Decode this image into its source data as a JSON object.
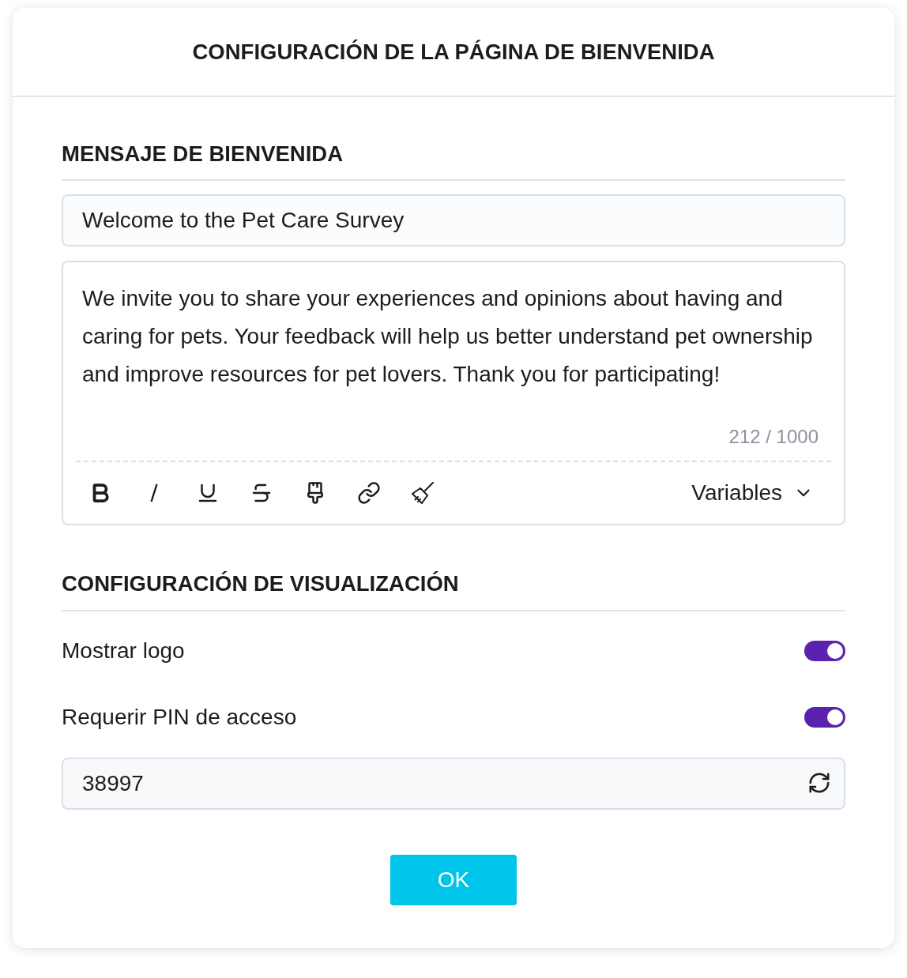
{
  "dialog": {
    "title": "CONFIGURACIÓN DE LA PÁGINA DE BIENVENIDA"
  },
  "welcome_message": {
    "heading": "MENSAJE DE BIENVENIDA",
    "title_field": {
      "value": "Welcome to the Pet Care Survey"
    },
    "body_field": {
      "value": "We invite you to share your experiences and opinions about having and caring for pets. Your feedback will help us better understand pet ownership and improve resources for pet lovers. Thank you for participating!",
      "counter": "212 / 1000"
    },
    "toolbar": {
      "dropdown": "Variables"
    }
  },
  "display_settings": {
    "heading": "CONFIGURACIÓN DE VISUALIZACIÓN",
    "toggles": [
      {
        "label": "Mostrar logo",
        "on": true
      },
      {
        "label": "Requerir PIN de acceso",
        "on": true
      }
    ],
    "pin_field": {
      "value": "38997"
    }
  },
  "buttons": [
    {
      "label": "OK"
    }
  ]
}
